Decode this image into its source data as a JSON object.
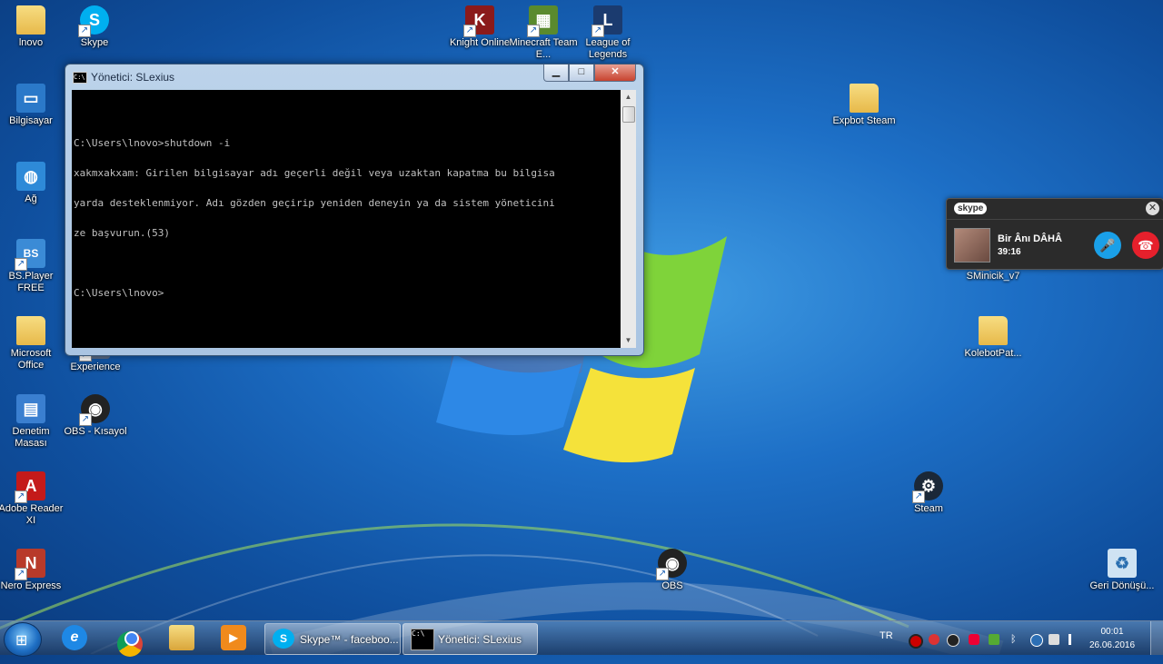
{
  "desktop_icons": [
    {
      "label": "lnovo",
      "kind": "folder"
    },
    {
      "label": "Skype",
      "kind": "skype"
    },
    {
      "label": "Knight Online",
      "kind": "game"
    },
    {
      "label": "Minecraft Team E...",
      "kind": "minecraft"
    },
    {
      "label": "League of Legends",
      "kind": "lol"
    },
    {
      "label": "Bilgisayar",
      "kind": "computer"
    },
    {
      "label": "Expbot Steam",
      "kind": "folder"
    },
    {
      "label": "Ağ",
      "kind": "network"
    },
    {
      "label": "BS.Player FREE",
      "kind": "bsplayer"
    },
    {
      "label": "SMinicik_v7",
      "kind": "app"
    },
    {
      "label": "Microsoft Office",
      "kind": "folder"
    },
    {
      "label": "Experience",
      "kind": "app"
    },
    {
      "label": "KolebotPat...",
      "kind": "folder"
    },
    {
      "label": "Denetim Masası",
      "kind": "control-panel"
    },
    {
      "label": "OBS - Kısayol",
      "kind": "obs"
    },
    {
      "label": "Adobe Reader XI",
      "kind": "adobe"
    },
    {
      "label": "Steam",
      "kind": "steam"
    },
    {
      "label": "Nero Express",
      "kind": "nero"
    },
    {
      "label": "OBS",
      "kind": "obs"
    },
    {
      "label": "Geri Dönüşü...",
      "kind": "recycle"
    }
  ],
  "cmd_window": {
    "title": "Yönetici:  SLexius",
    "icon_text": "C:\\",
    "buttons": {
      "minimize": "▁",
      "maximize": "□",
      "close": "✕"
    },
    "lines": [
      "C:\\Users\\lnovo>shutdown -i",
      "xakmxakxam: Girilen bilgisayar adı geçerli değil veya uzaktan kapatma bu bilgisa",
      "yarda desteklenmiyor. Adı gözden geçirip yeniden deneyin ya da sistem yöneticini",
      "ze başvurun.(53)",
      "",
      "C:\\Users\\lnovo>"
    ]
  },
  "skype_call": {
    "brand": "skype",
    "contact": "Bir Ânı DÂHÂ",
    "duration": "39:16",
    "close": "✕",
    "mute_glyph": "🎤",
    "hangup_glyph": "☎"
  },
  "taskbar": {
    "tasks": [
      {
        "label": "Skype™ - faceboo...",
        "icon": "skype-icon"
      },
      {
        "label": "Yönetici:  SLexius",
        "icon": "cmd-icon"
      }
    ],
    "language": "TR",
    "time": "00:01",
    "date": "26.06.2016"
  },
  "colors": {
    "skype_blue": "#00aff0",
    "chrome_red": "#db4437",
    "hangup_red": "#e6202c"
  }
}
